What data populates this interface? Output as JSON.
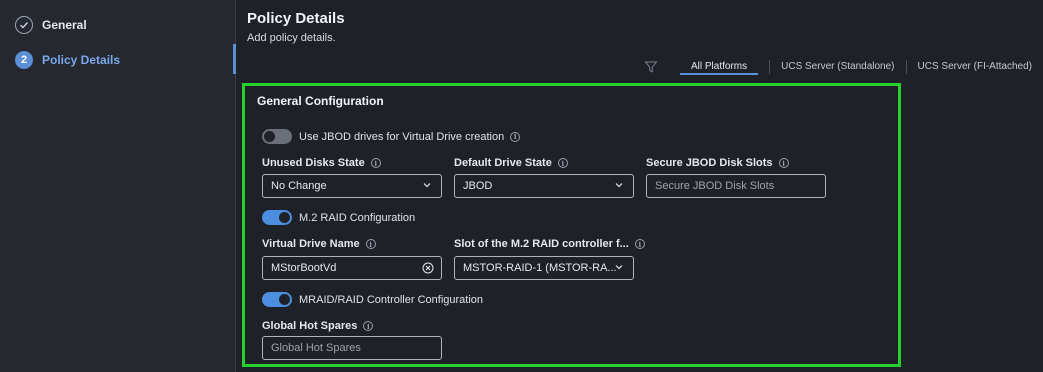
{
  "sidebar": {
    "steps": [
      {
        "number": "✓",
        "label": "General",
        "state": "done"
      },
      {
        "number": "2",
        "label": "Policy Details",
        "state": "active"
      }
    ]
  },
  "header": {
    "title": "Policy Details",
    "subtitle": "Add policy details."
  },
  "platform_tabs": [
    {
      "label": "All Platforms",
      "active": true
    },
    {
      "label": "UCS Server (Standalone)",
      "active": false
    },
    {
      "label": "UCS Server (FI-Attached)",
      "active": false
    }
  ],
  "section": {
    "title": "General Configuration"
  },
  "toggles": {
    "jbod": {
      "label": "Use JBOD drives for Virtual Drive creation",
      "on": false
    },
    "m2raid": {
      "label": "M.2 RAID Configuration",
      "on": true
    },
    "mraid": {
      "label": "MRAID/RAID Controller Configuration",
      "on": true
    }
  },
  "fields": {
    "unused_disks": {
      "label": "Unused Disks State",
      "value": "No Change"
    },
    "default_drive": {
      "label": "Default Drive State",
      "value": "JBOD"
    },
    "secure_jbod": {
      "label": "Secure JBOD Disk Slots",
      "placeholder": "Secure JBOD Disk Slots"
    },
    "virtual_drive_name": {
      "label": "Virtual Drive Name",
      "value": "MStorBootVd"
    },
    "m2_slot": {
      "label": "Slot of the M.2 RAID controller f...",
      "value": "MSTOR-RAID-1 (MSTOR-RA..."
    },
    "global_hot_spares": {
      "label": "Global Hot Spares",
      "placeholder": "Global Hot Spares"
    }
  },
  "colors": {
    "accent": "#5b8fd6",
    "highlight_frame": "#25d12c",
    "toggle_on": "#4c8ee0"
  }
}
